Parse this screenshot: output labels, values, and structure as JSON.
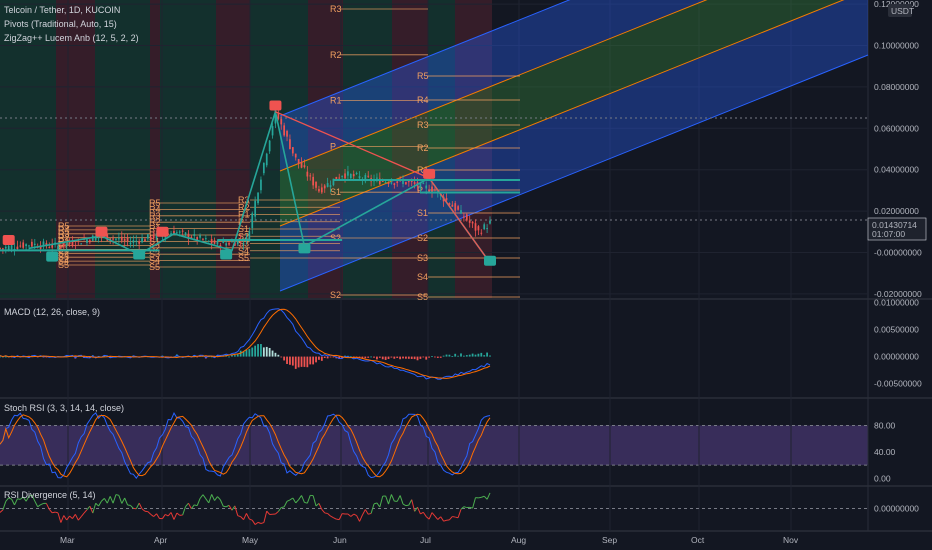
{
  "header": {
    "symbol": "Telcoin / Tether, 1D, KUCOIN",
    "indicators": [
      "Pivots (Traditional, Auto, 15)",
      "ZigZag++ Lucem Anb (12, 5, 2, 2)"
    ],
    "currency": "USDT"
  },
  "price_badge": {
    "price": "0.01430714",
    "countdown": "01:07:00"
  },
  "panes": {
    "macd": {
      "title": "MACD (12, 26, close, 9)"
    },
    "stoch": {
      "title": "Stoch RSI (3, 3, 14, 14, close)"
    },
    "rsidiv": {
      "title": "RSI Divergence (5, 14)"
    }
  },
  "x_axis": {
    "labels": [
      "Mar",
      "Apr",
      "May",
      "Jun",
      "Jul",
      "Aug",
      "Sep",
      "Oct",
      "Nov"
    ]
  },
  "chart_data": [
    {
      "type": "candlestick",
      "pane": "price",
      "ylim": [
        -0.022,
        0.122
      ],
      "y_ticks": [
        "0.12000000",
        "0.10000000",
        "0.08000000",
        "0.06000000",
        "0.04000000",
        "0.02000000",
        "-0.00000000",
        "-0.02000000"
      ],
      "pivot_labels_early": [
        "R5",
        "R4",
        "R3",
        "R2",
        "R1",
        "P",
        "S1",
        "S2",
        "S3",
        "S4",
        "S5"
      ],
      "pivots_may": [
        "R3",
        "R2",
        "R1",
        "P",
        "S1",
        "S2",
        "S3",
        "S4",
        "S5"
      ],
      "pivots_jun": [
        "R3",
        "R2",
        "R1",
        "P",
        "S1",
        "S2"
      ],
      "pivots_jul": [
        "R5",
        "R4",
        "R3",
        "R2",
        "R1",
        "P",
        "S1",
        "S2",
        "S3",
        "S4",
        "S5"
      ]
    },
    {
      "type": "line",
      "pane": "macd",
      "ylim": [
        -0.0075,
        0.0105
      ],
      "y_ticks": [
        "0.01000000",
        "0.00500000",
        "0.00000000",
        "-0.00500000"
      ]
    },
    {
      "type": "line",
      "pane": "stoch",
      "ylim": [
        -10,
        120
      ],
      "y_ticks": [
        "80.00",
        "40.00",
        "0.00"
      ]
    },
    {
      "type": "line",
      "pane": "rsidiv",
      "ylim": [
        -1,
        1
      ],
      "y_ticks": [
        "0.00000000"
      ]
    }
  ],
  "colors": {
    "bg": "#131722",
    "up": "#26a69a",
    "down": "#ef5350",
    "zigzag": "#26a69a",
    "pivot": "#f0a060",
    "channel_blue": "#2962ff",
    "channel_green": "#4caf50",
    "macd": "#2962ff",
    "signal": "#ff6d00",
    "k": "#2962ff",
    "d": "#ff6d00",
    "stoch_band": "#7e57c2"
  }
}
